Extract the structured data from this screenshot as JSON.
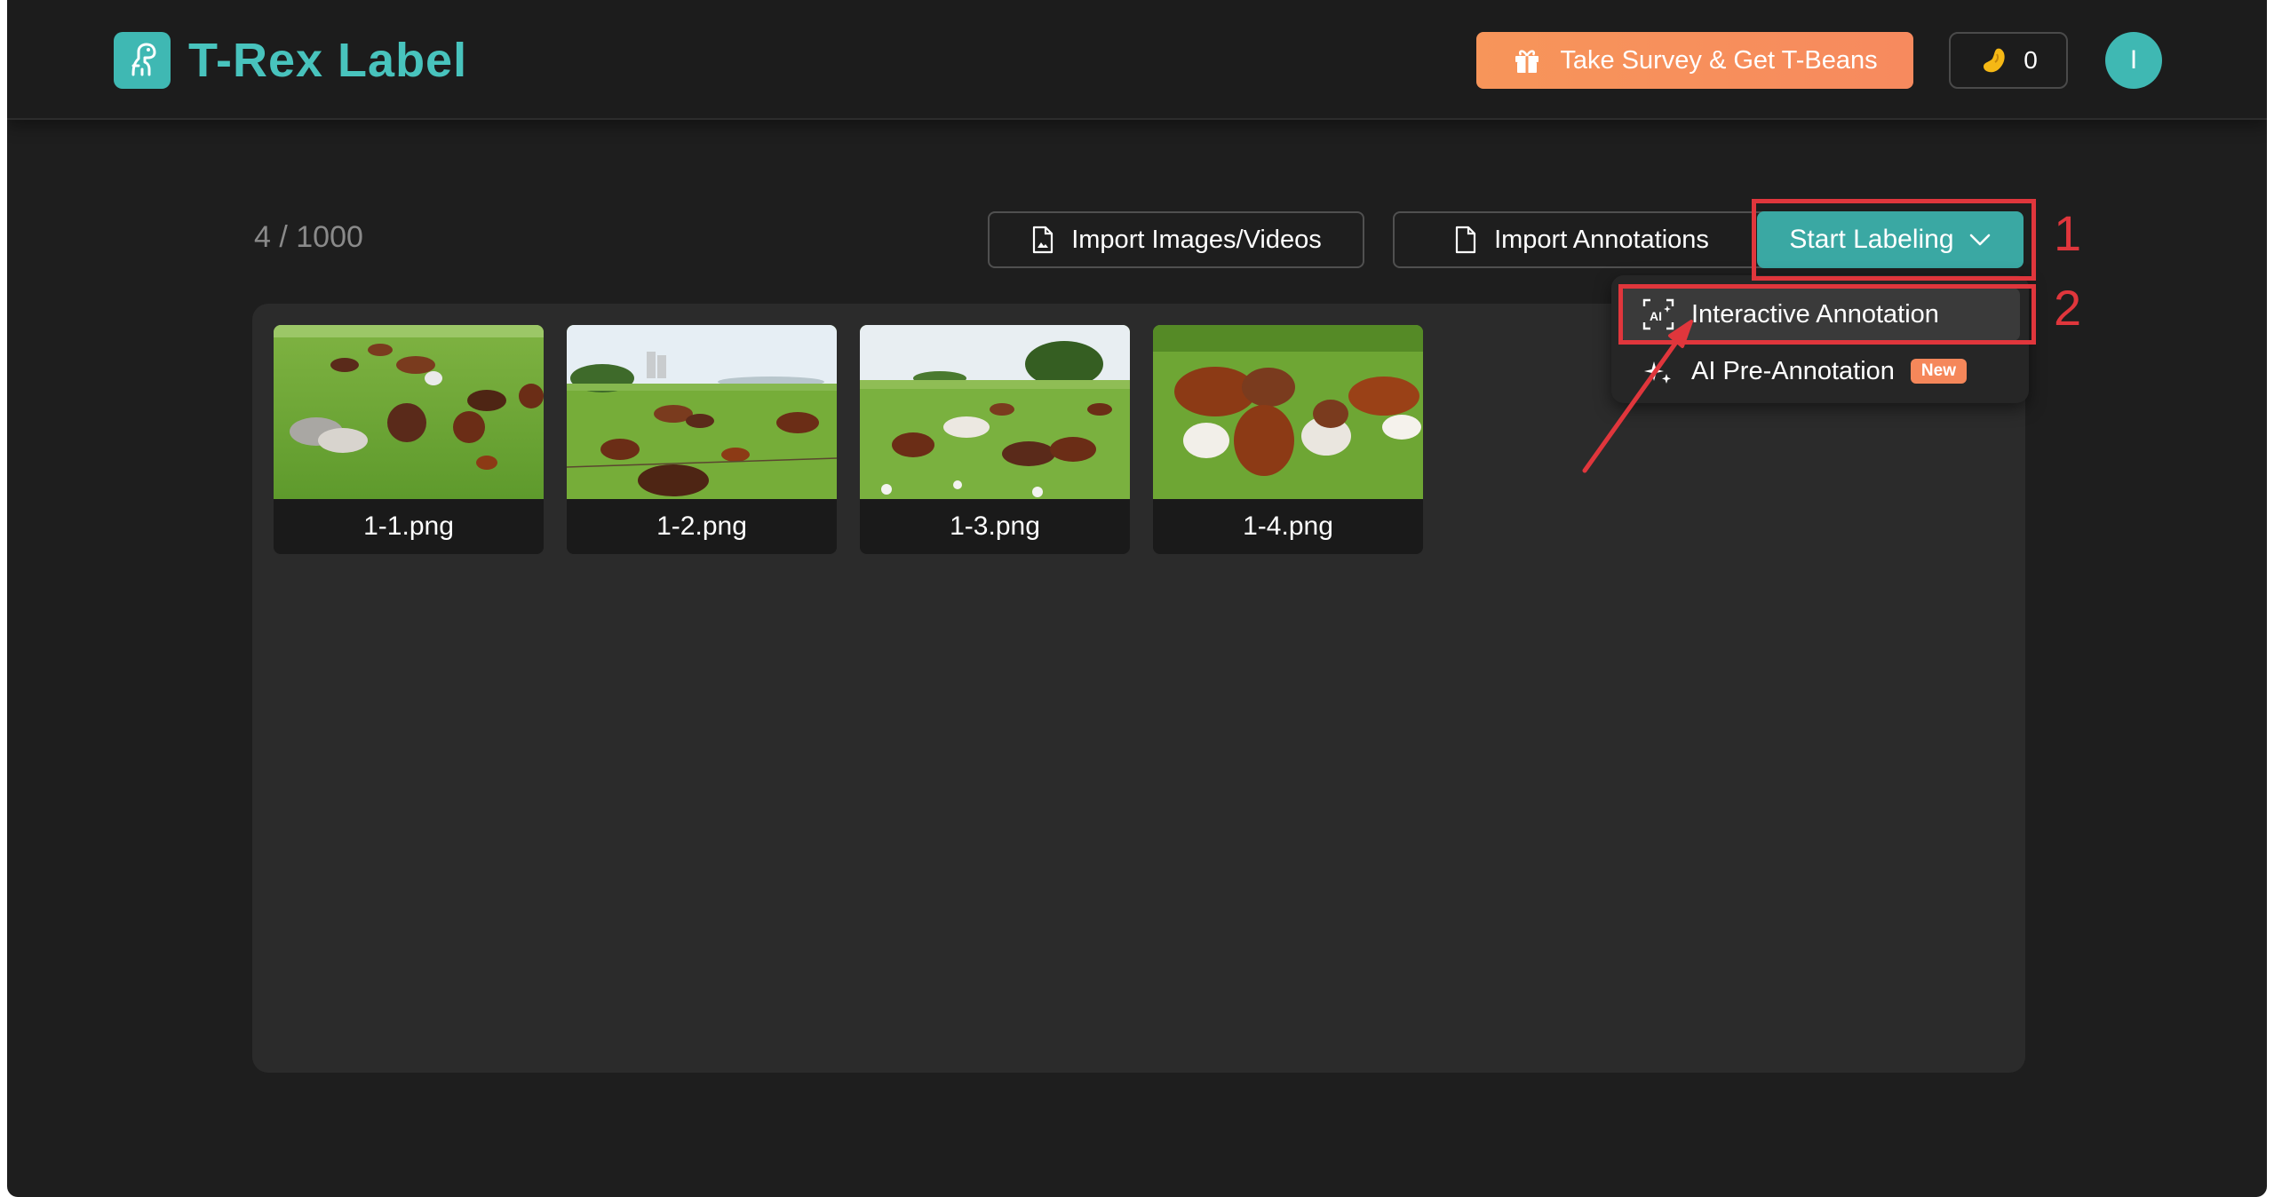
{
  "app": {
    "name": "T-Rex Label"
  },
  "header": {
    "survey_label": "Take Survey & Get T-Beans",
    "beans_count": "0",
    "avatar_initial": "I"
  },
  "toolbar": {
    "counter": "4 / 1000",
    "import_images_label": "Import Images/Videos",
    "import_annotations_label": "Import Annotations",
    "start_labeling_label": "Start Labeling"
  },
  "dropdown": {
    "items": [
      {
        "label": "Interactive Annotation",
        "icon": "ai-box-icon"
      },
      {
        "label": "AI Pre-Annotation",
        "icon": "sparkle-icon",
        "badge": "New"
      }
    ]
  },
  "gallery": {
    "images": [
      {
        "name": "1-1.png"
      },
      {
        "name": "1-2.png"
      },
      {
        "name": "1-3.png"
      },
      {
        "name": "1-4.png"
      }
    ]
  },
  "annotations": {
    "step1": "1",
    "step2": "2"
  },
  "colors": {
    "accent": "#3fb8b3",
    "survey": "#f7955a",
    "highlight": "#e0363c",
    "background": "#1e1e1e"
  }
}
